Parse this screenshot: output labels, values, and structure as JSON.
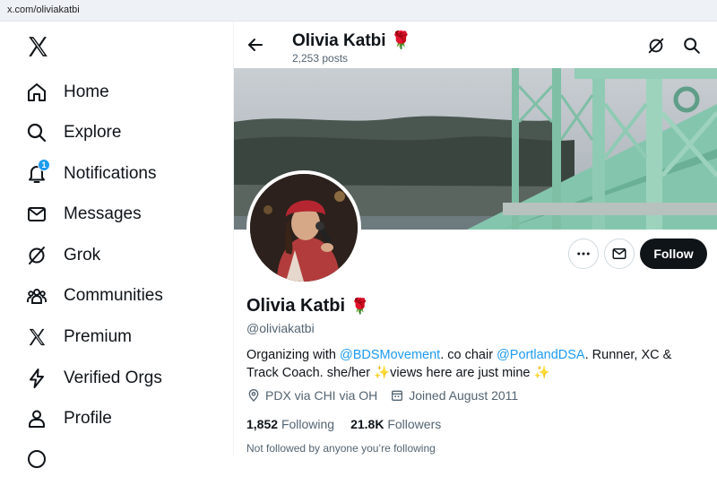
{
  "browser": {
    "url": "x.com/oliviakatbi"
  },
  "sidebar": {
    "items": [
      {
        "label": "Home"
      },
      {
        "label": "Explore"
      },
      {
        "label": "Notifications",
        "badge": "1"
      },
      {
        "label": "Messages"
      },
      {
        "label": "Grok"
      },
      {
        "label": "Communities"
      },
      {
        "label": "Premium"
      },
      {
        "label": "Verified Orgs"
      },
      {
        "label": "Profile"
      }
    ]
  },
  "header": {
    "name": "Olivia Katbi",
    "posts": "2,253 posts"
  },
  "profile": {
    "name": "Olivia Katbi",
    "emoji": "🌹",
    "handle": "@oliviakatbi",
    "bio": {
      "p1": "Organizing with ",
      "m1": "@BDSMovement",
      "p2": ". co chair ",
      "m2": "@PortlandDSA",
      "p3": ". Runner, XC & Track Coach. she/her ✨views here are just mine ✨"
    },
    "location": "PDX via CHI via OH",
    "joined": "Joined August 2011",
    "following_count": "1,852",
    "following_label": "Following",
    "followers_count": "21.8K",
    "followers_label": "Followers",
    "not_followed": "Not followed by anyone you’re following"
  },
  "actions": {
    "follow": "Follow"
  },
  "colors": {
    "accent": "#1d9bf0",
    "text": "#0f1419",
    "muted": "#536471",
    "banner_bridge": "#8cc7b0"
  }
}
